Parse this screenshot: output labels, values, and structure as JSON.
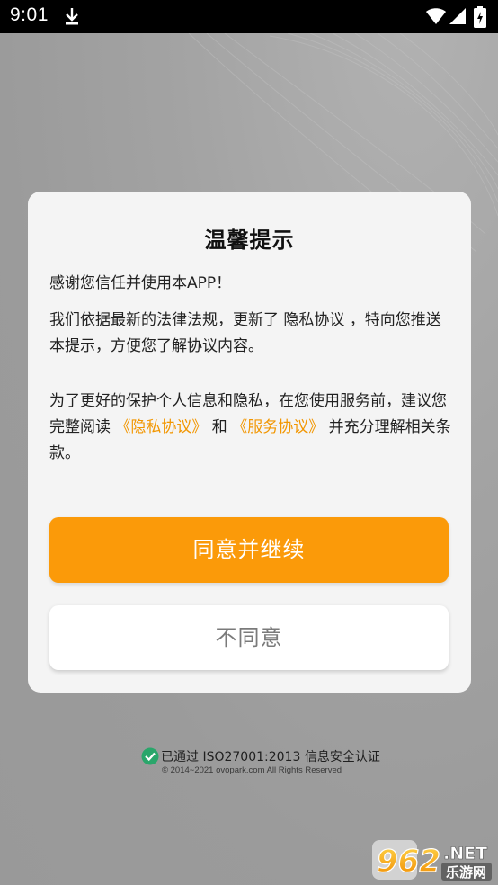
{
  "status_bar": {
    "time": "9:01",
    "icons": [
      "download-icon",
      "wifi-icon",
      "signal-icon",
      "battery-icon"
    ]
  },
  "dialog": {
    "title": "温馨提示",
    "paragraph1": "感谢您信任并使用本APP！",
    "paragraph2": "我们依据最新的法律法规，更新了 隐私协议 ，特向您推送本提示，方便您了解协议内容。",
    "paragraph3_before": "为了更好的保护个人信息和隐私，在您使用服务前，建议您完整阅读 ",
    "privacy_link": "《隐私协议》",
    "paragraph3_middle": " 和 ",
    "service_link": "《服务协议》",
    "paragraph3_after": " 并充分理解相关条款。",
    "agree_button": "同意并继续",
    "disagree_button": "不同意"
  },
  "footer": {
    "certification": "已通过 ISO27001:2013 信息安全认证",
    "copyright": "© 2014~2021 ovopark.com All Rights Reserved"
  },
  "watermark": {
    "brand": "962.NET",
    "subtitle": "乐游网"
  },
  "colors": {
    "accent": "#fb9a09",
    "link": "#f29600",
    "cert_green": "#2aa66b",
    "dialog_bg": "#f4f4f4"
  }
}
